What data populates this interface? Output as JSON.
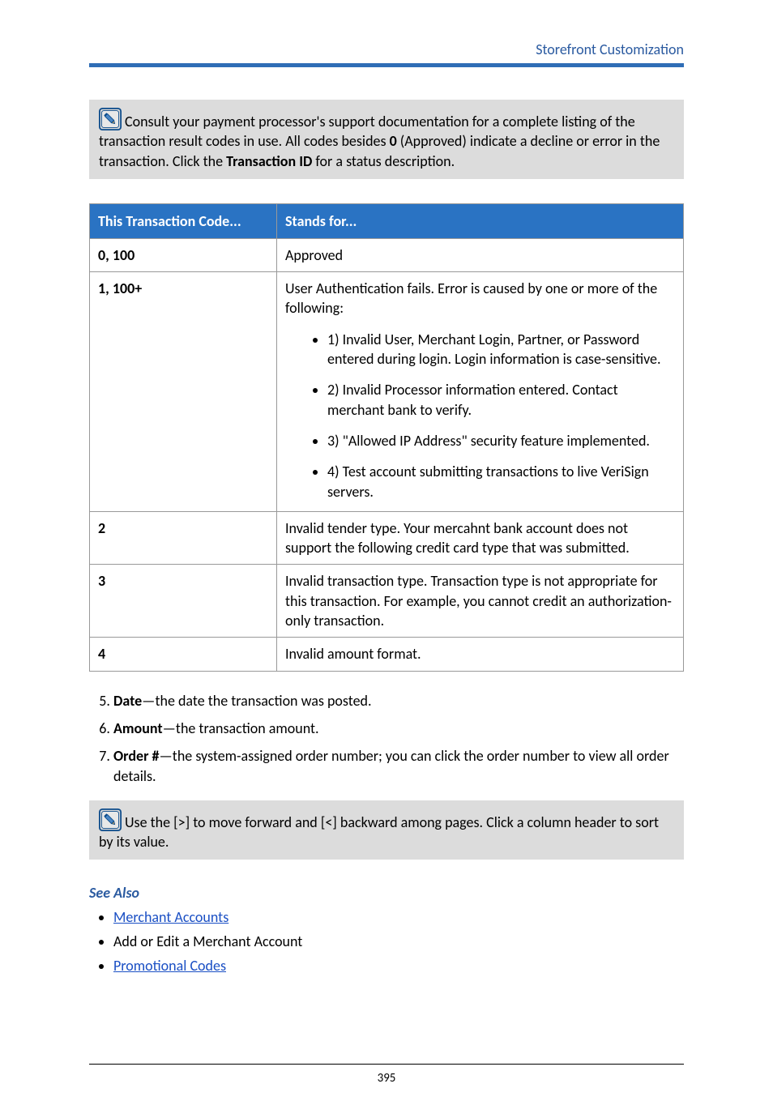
{
  "header": {
    "section_title": "Storefront Customization"
  },
  "note1": {
    "pre": "Consult your payment processor's support documentation for a complete listing of the transaction result codes in use. All codes besides ",
    "bold1": "0",
    "mid1": " (Approved) indicate a decline or error in the transaction. Click the ",
    "bold2": "Transaction ID",
    "post": " for a status description."
  },
  "chart_data": {
    "type": "table",
    "title": "",
    "columns": [
      "This Transaction Code...",
      "Stands for..."
    ],
    "rows": [
      {
        "code": "0, 100",
        "desc": "Approved",
        "bullets": []
      },
      {
        "code": "1, 100+",
        "desc": "User Authentication fails. Error is caused by one or more of the following:",
        "bullets": [
          "1) Invalid User, Merchant Login, Partner, or Password entered during login. Login information is case-sensitive.",
          "2) Invalid Processor information entered. Contact merchant bank to verify.",
          "3) \"Allowed IP Address\" security feature implemented.",
          "4) Test account submitting transactions to live VeriSign servers."
        ]
      },
      {
        "code": "2",
        "desc": "Invalid tender type. Your mercahnt bank account does not support the following credit card type that was submitted.",
        "bullets": []
      },
      {
        "code": "3",
        "desc": "Invalid transaction type. Transaction type is not appropriate for this transaction. For example, you cannot credit an authorization-only transaction.",
        "bullets": []
      },
      {
        "code": "4",
        "desc": "Invalid amount format.",
        "bullets": []
      }
    ]
  },
  "defs": {
    "start": 5,
    "items": [
      {
        "term": "Date",
        "text": "—the date the transaction was posted."
      },
      {
        "term": "Amount",
        "text": "—the transaction amount."
      },
      {
        "term": "Order #",
        "text": "—the system-assigned order number; you can click the order number to view all order details."
      }
    ]
  },
  "note2": {
    "text": "Use the [>] to move forward and [<] backward among pages. Click a column header to sort by its value."
  },
  "see_also": {
    "heading": "See Also",
    "items": [
      {
        "label": "Merchant Accounts",
        "link": true
      },
      {
        "label": "Add or Edit a Merchant Account",
        "link": false
      },
      {
        "label": "Promotional Codes",
        "link": true
      }
    ]
  },
  "page_number": "395"
}
